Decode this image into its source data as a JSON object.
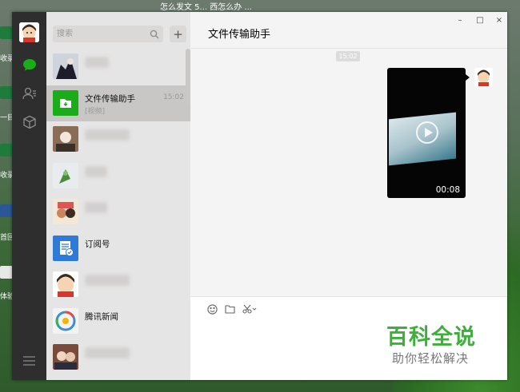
{
  "desktop": {
    "top_text": "怎么发文 5... 西怎么办 ...",
    "icon_labels": [
      "收录",
      "一目\n合说",
      "收录",
      "首回",
      "体验\n邦"
    ]
  },
  "window": {
    "controls": {
      "minimize": "–",
      "maximize": "□",
      "close": "×"
    }
  },
  "search": {
    "placeholder": "搜索",
    "add_label": "+"
  },
  "chats": [
    {
      "name": "",
      "preview": "",
      "time": ""
    },
    {
      "name": "文件传输助手",
      "preview": "[视频]",
      "time": "15:02"
    },
    {
      "name": "",
      "preview": "",
      "time": ""
    },
    {
      "name": "",
      "preview": "",
      "time": ""
    },
    {
      "name": "",
      "preview": "",
      "time": ""
    },
    {
      "name": "订阅号",
      "preview": "",
      "time": ""
    },
    {
      "name": "",
      "preview": "",
      "time": ""
    },
    {
      "name": "腾讯新闻",
      "preview": "",
      "time": ""
    },
    {
      "name": "",
      "preview": "",
      "time": ""
    }
  ],
  "conversation": {
    "title": "文件传输助手",
    "timestamp": "15:02",
    "video_duration": "00:08"
  },
  "watermark": {
    "title": "百科全说",
    "subtitle": "助你轻松解决"
  },
  "colors": {
    "nav_bg": "#2e2e2e",
    "sidebar_bg": "#e6e5e5",
    "selected_bg": "#c8c7c6",
    "main_bg": "#f4f4f4",
    "wechat_green": "#1aad19",
    "watermark_green": "#3db039"
  }
}
